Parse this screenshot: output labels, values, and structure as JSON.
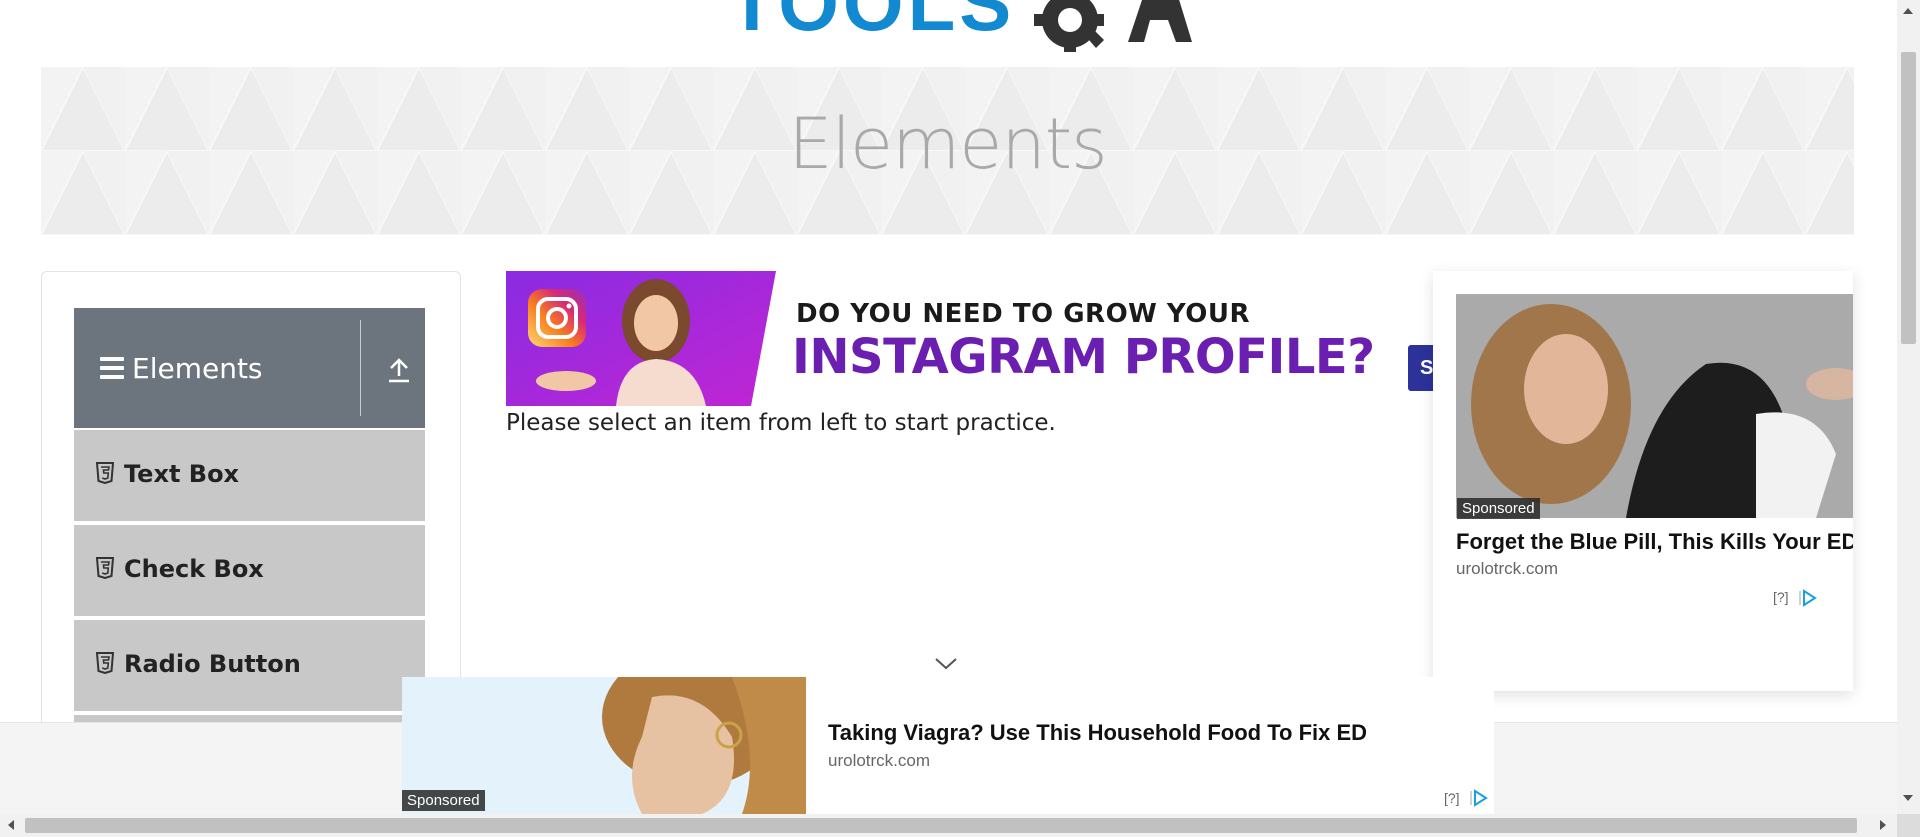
{
  "logo": {
    "text": "TOOLS"
  },
  "banner": {
    "title": "Elements"
  },
  "sidebar": {
    "group": {
      "label": "Elements"
    },
    "items": [
      {
        "label": "Text Box"
      },
      {
        "label": "Check Box"
      },
      {
        "label": "Radio Button"
      }
    ]
  },
  "main": {
    "instagram_ad": {
      "line1": "DO YOU NEED TO GROW YOUR",
      "line2": "INSTAGRAM PROFILE?",
      "button_partial": "S"
    },
    "instruction": "Please select an item from left to start practice."
  },
  "right_ad": {
    "sponsored": "Sponsored",
    "headline": "Forget the Blue Pill, This Kills Your ED",
    "domain": "urolotrck.com",
    "qmark": "[?]"
  },
  "bottom_ad": {
    "sponsored": "Sponsored",
    "headline": "Taking Viagra? Use This Household Food To Fix ED",
    "domain": "urolotrck.com",
    "qmark": "[?]"
  },
  "colors": {
    "header_gray": "#6c757d",
    "item_gray": "#c8c8c8",
    "logo_blue": "#1289d1",
    "instagram_purple": "#6a1fb0"
  }
}
